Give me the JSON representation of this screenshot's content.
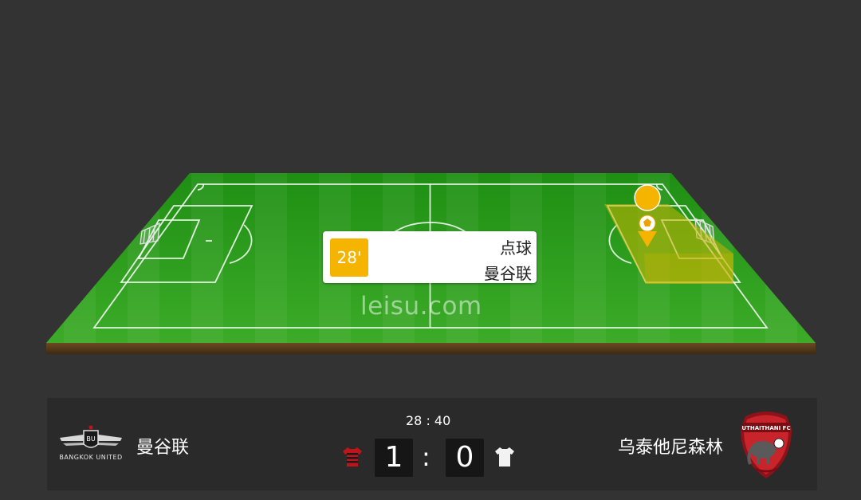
{
  "event": {
    "minute": "28'",
    "type": "点球",
    "team": "曼谷联"
  },
  "watermark": "leisu.com",
  "match": {
    "time": "28 : 40",
    "home": {
      "name": "曼谷联",
      "logo_text": "BANGKOK UNITED",
      "logo_icon": "bangkok-united-crest",
      "jersey_icon": "striped-jersey-red-black",
      "score": "1"
    },
    "separator": ":",
    "away": {
      "name": "乌泰他尼森林",
      "logo_text": "UTHAITHANI FC",
      "logo_icon": "uthaithani-fc-crest",
      "jersey_icon": "white-jersey",
      "score": "0"
    }
  },
  "colors": {
    "background": "#333333",
    "scorebar": "#2a2a2a",
    "pitch_green": "#2e9e1e",
    "minute_badge": "#f5b400",
    "danger_zone": "#c8b400",
    "home_red": "#c0141c",
    "away_red": "#c8242c"
  }
}
